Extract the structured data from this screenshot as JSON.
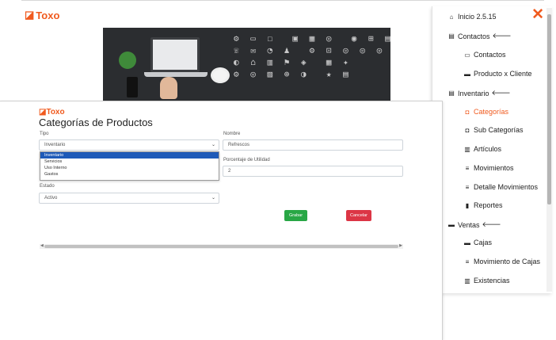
{
  "brand": {
    "name": "Toxo",
    "color": "#f05a1e"
  },
  "back_window": {
    "hero_alt": "",
    "hero_icons_text": "⚙ ▭ ☐  ▣ ▦ ◎  ◉ ⊞ ▤\n☏ ✉ ◔ ♟  ⚙ ⊡ ◎ ◎ ◎\n◐ ⌂ ▥ ⚑ ◈  ▦ ✦\n⚙ ◎ ▨ ⊕ ◑  ★ ▤"
  },
  "side_menu": {
    "close_label": "✕",
    "items": [
      {
        "icon": "home-icon",
        "glyph": "⌂",
        "label": "Inicio 2.5.15",
        "active": false
      },
      {
        "icon": "contacts-icon",
        "glyph": "▤",
        "label": "Contactos",
        "arrow": "🡐",
        "active": false
      },
      {
        "icon": "id-card-icon",
        "glyph": "▭",
        "label": "Contactos",
        "active": false
      },
      {
        "icon": "credit-card-icon",
        "glyph": "▬",
        "label": "Producto x Cliente",
        "active": false
      },
      {
        "icon": "inventory-icon",
        "glyph": "▤",
        "label": "Inventario",
        "arrow": "🡐",
        "active": false
      },
      {
        "icon": "shopping-bag-icon",
        "glyph": "◘",
        "label": "Categorías",
        "active": true
      },
      {
        "icon": "shopping-bag-icon",
        "glyph": "◘",
        "label": "Sub Categorías",
        "active": false
      },
      {
        "icon": "basket-icon",
        "glyph": "▥",
        "label": "Artículos",
        "active": false
      },
      {
        "icon": "list-icon",
        "glyph": "≡",
        "label": "Movimientos",
        "active": false
      },
      {
        "icon": "list-icon",
        "glyph": "≡",
        "label": "Detalle Movimientos",
        "active": false
      },
      {
        "icon": "file-icon",
        "glyph": "▮",
        "label": "Reportes",
        "active": false
      },
      {
        "icon": "sales-icon",
        "glyph": "▬",
        "label": "Ventas",
        "arrow": "🡐",
        "active": false
      },
      {
        "icon": "cash-register-icon",
        "glyph": "▬",
        "label": "Cajas",
        "active": false
      },
      {
        "icon": "list-icon",
        "glyph": "≡",
        "label": "Movimiento de Cajas",
        "active": false
      },
      {
        "icon": "basket-icon",
        "glyph": "▥",
        "label": "Existencias",
        "active": false
      }
    ]
  },
  "form": {
    "logo": "Toxo",
    "title": "Categorías de Productos",
    "tipo_label": "Tipo",
    "tipo_value": "Inventario",
    "tipo_options": [
      "Inventario",
      "Servicios",
      "Uso Interno",
      "Gastos"
    ],
    "nombre_label": "Nombre",
    "nombre_value": "Refrescos",
    "porcentaje_label": "Porcentaje de Utilidad",
    "porcentaje_value": "2",
    "estado_label": "Estado",
    "estado_value": "Activo",
    "save_label": "Grabar",
    "cancel_label": "Cancelar"
  }
}
